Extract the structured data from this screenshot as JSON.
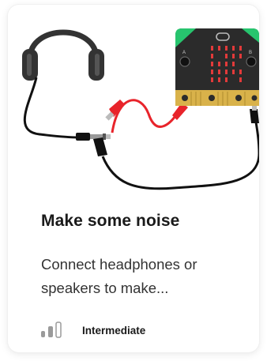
{
  "project": {
    "title": "Make some noise",
    "description": "Connect headphones or speakers to make...",
    "level": {
      "label": "Intermediate",
      "icon": "difficulty-bars-icon",
      "filled_bars": 2,
      "total_bars": 3
    }
  },
  "colors": {
    "clip_red": "#e8242b",
    "board_green": "#27c46e",
    "led_red": "#e23a3a",
    "gold_pins": "#d9b24a",
    "cable": "#111111"
  }
}
